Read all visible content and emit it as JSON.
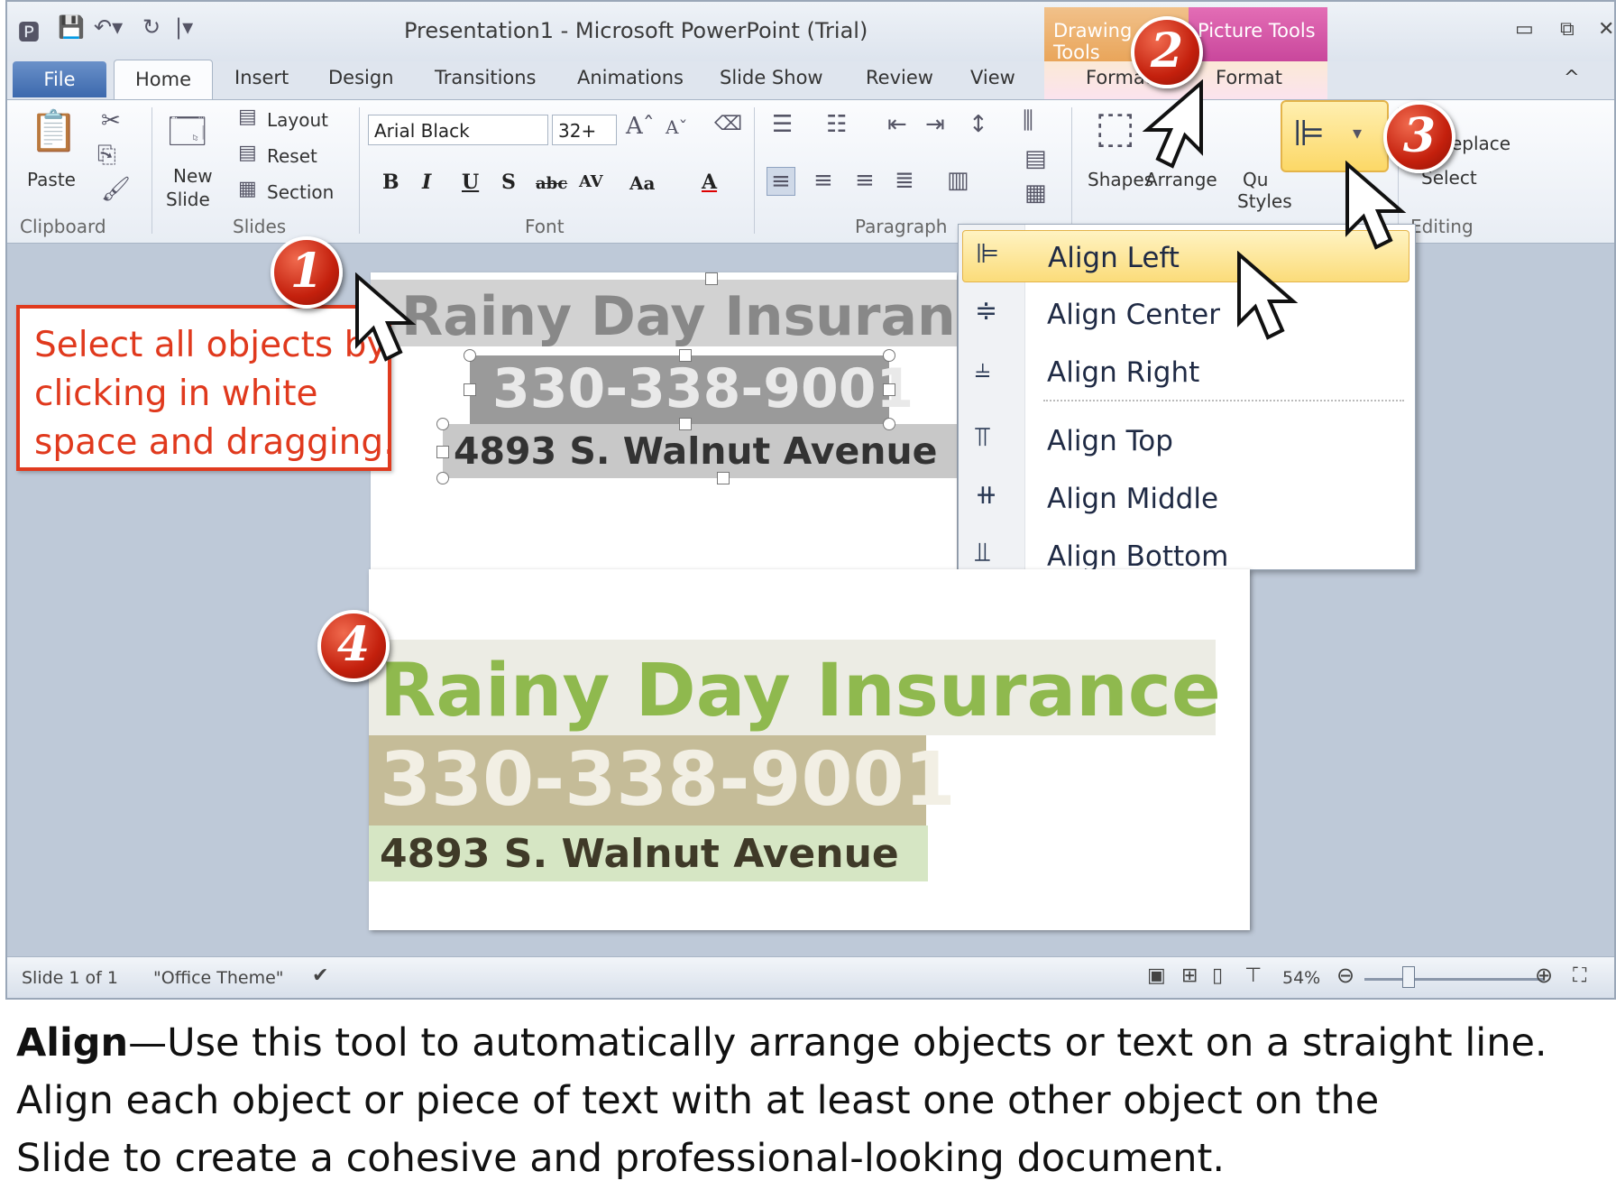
{
  "window": {
    "title": "Presentation1  -  Microsoft PowerPoint (Trial)",
    "context_tabs": {
      "drawing": "Drawing Tools",
      "picture": "Picture Tools"
    },
    "controls": [
      "▭",
      "⧉",
      "✕"
    ]
  },
  "tabs": [
    "File",
    "Home",
    "Insert",
    "Design",
    "Transitions",
    "Animations",
    "Slide Show",
    "Review",
    "View",
    "Format",
    "Format"
  ],
  "ribbon": {
    "clipboard": {
      "paste": "Paste",
      "label": "Clipboard"
    },
    "slides": {
      "new_slide": [
        "New",
        "Slide"
      ],
      "layout": "Layout",
      "reset": "Reset",
      "section": "Section",
      "label": "Slides"
    },
    "font": {
      "name": "Arial Black",
      "size": "32+",
      "label": "Font"
    },
    "paragraph": {
      "label": "Paragraph"
    },
    "drawing": {
      "shapes": "Shapes",
      "arrange": "Arrange",
      "quick_styles": [
        "Qu",
        "Styles"
      ]
    },
    "editing": {
      "replace": "Replace",
      "select": "Select",
      "label": "Editing"
    }
  },
  "slide_before": {
    "title": "Rainy Day Insurance",
    "phone": "330-338-9001",
    "address": "4893 S. Walnut Avenue"
  },
  "align_menu": {
    "items": [
      {
        "label": "Align Left",
        "icon": "align-left-icon",
        "highlighted": true
      },
      {
        "label": "Align Center",
        "icon": "align-center-icon"
      },
      {
        "label": "Align Right",
        "icon": "align-right-icon"
      },
      {
        "label": "Align Top",
        "icon": "align-top-icon"
      },
      {
        "label": "Align Middle",
        "icon": "align-middle-icon"
      },
      {
        "label": "Align Bottom",
        "icon": "align-bottom-icon"
      }
    ]
  },
  "slide_after": {
    "title": "Rainy Day Insurance",
    "phone": "330-338-9001",
    "address": "4893 S. Walnut Avenue",
    "colors": {
      "title": "#8fb94e",
      "title_bg": "#ecece4",
      "phone_bg": "#c5bc98",
      "address_bg": "#d6e6c4"
    }
  },
  "status": {
    "slide": "Slide 1 of 1",
    "theme": "\"Office Theme\"",
    "zoom": "54%"
  },
  "callout": {
    "lines": [
      "Select all objects by",
      "clicking in white",
      "space and dragging."
    ]
  },
  "badges": [
    "1",
    "2",
    "3",
    "4"
  ],
  "caption": {
    "bold": "Align",
    "line1_rest": "—Use this tool to automatically arrange objects or text on a straight line.",
    "line2": "Align each object or piece of text with at least one other object on the",
    "line3": "Slide to create a cohesive and professional-looking document."
  },
  "accent_colors": {
    "callout_red": "#e0391d",
    "highlight": "#fbdc7a"
  }
}
